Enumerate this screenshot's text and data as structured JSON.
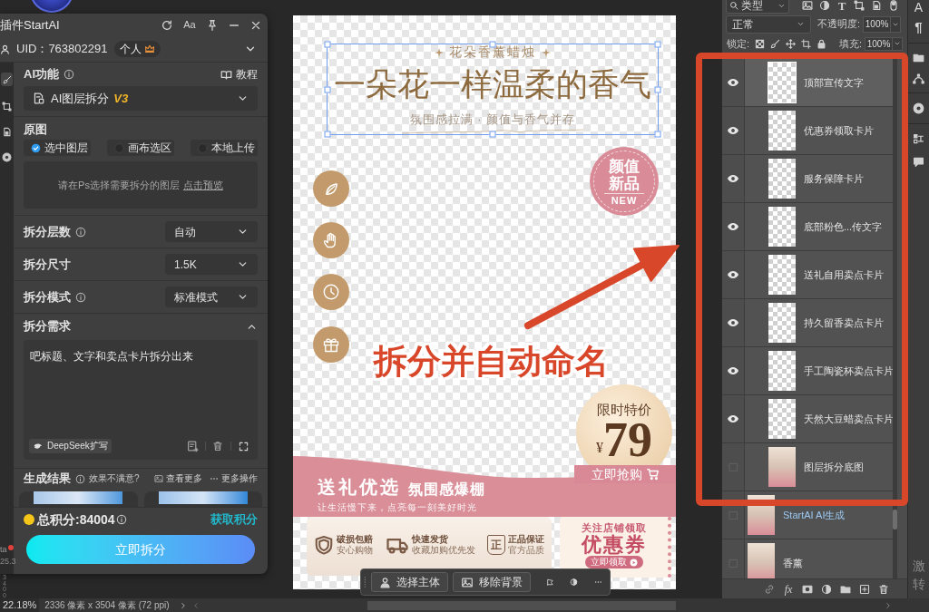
{
  "plugin_panel": {
    "title": "插件StartAI",
    "font_button": "Aa",
    "uid": "UID：763802291",
    "plan": "个人",
    "ai_function": {
      "label": "AI功能",
      "tutorial": "教程",
      "value": "AI图层拆分",
      "version": "V3"
    },
    "source": {
      "label": "原图",
      "options": [
        {
          "label": "选中图层",
          "selected": true
        },
        {
          "label": "画布选区",
          "selected": false
        },
        {
          "label": "本地上传",
          "selected": false
        }
      ],
      "hint": "请在Ps选择需要拆分的图层",
      "preview_link": "点击预览"
    },
    "settings": [
      {
        "label": "拆分层数",
        "info": true,
        "value": "自动"
      },
      {
        "label": "拆分尺寸",
        "info": false,
        "value": "1.5K"
      },
      {
        "label": "拆分模式",
        "info": true,
        "value": "标准模式"
      }
    ],
    "requirement": {
      "label": "拆分需求",
      "expanded": true,
      "text": "吧标题、文字和卖点卡片拆分出来",
      "expand_button": "DeepSeek扩写"
    },
    "results": {
      "label": "生成结果",
      "feedback": "效果不满意?",
      "view_more": "查看更多",
      "more_actions": "更多操作"
    },
    "points": {
      "total": "总积分:84004",
      "earn": "获取积分"
    },
    "submit": "立即拆分"
  },
  "canvas": {
    "document": {
      "eyebrow": "花朵香薰蜡烛",
      "headline": "一朵花一样温柔的香气",
      "subline": "氛围感拉满 · 颜值与香气并存",
      "new_badge": {
        "line_1": "颜值",
        "line_2": "新品",
        "tag": "NEW"
      },
      "price_badge": {
        "label": "限时特价",
        "currency": "¥",
        "price": "79",
        "button": "立即抢购"
      },
      "banner": {
        "title": "送礼优选",
        "subtitle": "氛围感爆棚",
        "tagline": "让生活慢下来，点亮每一刻美好时光"
      },
      "guarantees": [
        {
          "kind": "shield",
          "title": "破损包赔",
          "note": "安心购物"
        },
        {
          "kind": "truck",
          "title": "快速发货",
          "note": "收藏加购优先发"
        },
        {
          "kind": "genuine",
          "glyph": "正",
          "title": "正品保证",
          "note": "官方品质"
        }
      ],
      "coupon": {
        "caption": "关注店铺领取",
        "title": "优惠券",
        "button": "立即领取"
      }
    },
    "annotation": "拆分并自动命名",
    "toolbar": [
      {
        "kind": "subject",
        "label": "选择主体"
      },
      {
        "kind": "background",
        "label": "移除背景"
      }
    ]
  },
  "layers_panel": {
    "filter": "类型",
    "filter_glyph": "T",
    "blend_mode": "正常",
    "opacity_label": "不透明度:",
    "opacity": "100%",
    "lock_label": "锁定:",
    "fill_label": "填充:",
    "fill": "100%",
    "group_layers": [
      {
        "name": "顶部宣传文字",
        "kind": "transparent",
        "visible": true,
        "selected": true
      },
      {
        "name": "优惠券领取卡片",
        "kind": "transparent",
        "visible": true,
        "selected": false
      },
      {
        "name": "服务保障卡片",
        "kind": "transparent",
        "visible": true,
        "selected": false
      },
      {
        "name": "底部粉色...传文字",
        "kind": "transparent",
        "visible": true,
        "selected": false
      },
      {
        "name": "送礼自用卖点卡片",
        "kind": "transparent",
        "visible": true,
        "selected": false
      },
      {
        "name": "持久留香卖点卡片",
        "kind": "transparent",
        "visible": true,
        "selected": false
      },
      {
        "name": "手工陶瓷杯卖点卡片",
        "kind": "transparent",
        "visible": true,
        "selected": false
      },
      {
        "name": "天然大豆蜡卖点卡片",
        "kind": "transparent",
        "visible": true,
        "selected": false
      },
      {
        "name": "图层拆分底图",
        "kind": "photo",
        "visible": false,
        "selected": false
      }
    ],
    "layers": [
      {
        "name": "StartAI AI生成",
        "kind": "ai",
        "visible": false,
        "selected": false
      },
      {
        "name": "香薰",
        "kind": "photo",
        "visible": false,
        "selected": false
      }
    ],
    "footer_glyph": "fx"
  },
  "status_bar": {
    "zoom": "22.18%",
    "doc_size": "2336 像素 x 3504 像素 (72 ppi)"
  },
  "left_edge": {
    "label": "ta",
    "value": "25.3",
    "ruler": "3400"
  },
  "dock": {
    "glyphs": [
      "A",
      "¶"
    ],
    "edge_text": [
      "激",
      "转"
    ]
  }
}
